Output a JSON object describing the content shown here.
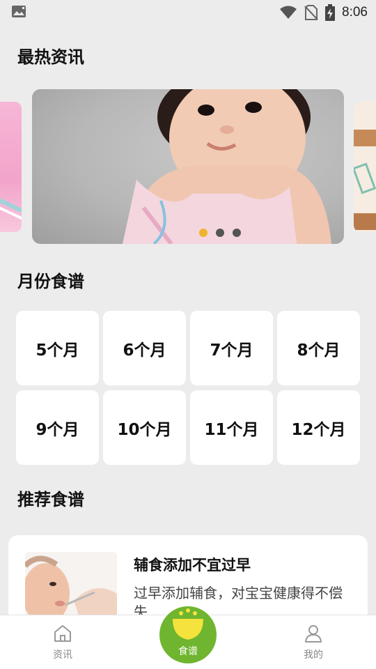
{
  "status_bar": {
    "time": "8:06",
    "icons": [
      "image-notification-icon",
      "wifi-icon",
      "no-sim-icon",
      "battery-charging-icon"
    ]
  },
  "sections": {
    "news_title": "最热资讯",
    "month_title": "月份食谱",
    "recommend_title": "推荐食谱"
  },
  "carousel": {
    "slide_count": 3,
    "active_index": 0,
    "active_color": "#f0b429"
  },
  "months": [
    "5个月",
    "6个月",
    "7个月",
    "8个月",
    "9个月",
    "10个月",
    "11个月",
    "12个月"
  ],
  "recommend": {
    "title": "辅食添加不宜过早",
    "description": "过早添加辅食，对宝宝健康得不偿失"
  },
  "bottom_nav": {
    "items": [
      {
        "label": "资讯",
        "icon": "home-icon"
      },
      {
        "label": "食谱",
        "icon": "bowl-icon"
      },
      {
        "label": "我的",
        "icon": "person-icon"
      }
    ],
    "accent": "#6fb52f"
  }
}
